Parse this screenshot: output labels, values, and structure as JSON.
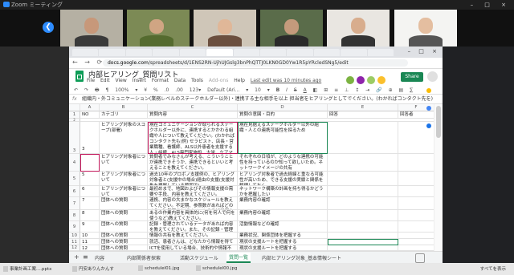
{
  "zoom": {
    "title": "Zoom ミーティング",
    "window_controls": "– □ ×"
  },
  "browser": {
    "nav": "← → ⟳",
    "url_host": "docs.google.com",
    "url_path": "/spreadsheets/d/1ENS2RN-UjhUJGslg3bnPhQTTJ0LKN0GD0Yw1R5pYRcledSNg5/edit"
  },
  "sheet": {
    "title": "内部ヒアリング_質問リスト",
    "star": "☆",
    "menus": [
      "File",
      "Edit",
      "View",
      "Insert",
      "Format",
      "Data",
      "Tools",
      "Add-ons",
      "Help"
    ],
    "last_edit": "Last edit was 10 minutes ago",
    "share_label": "Share",
    "toolbar": [
      "↶",
      "↷",
      "🖶",
      "¶",
      "100%",
      "▾",
      "¥",
      "%",
      ".0",
      ".00",
      "123▾",
      "Default (Ari...",
      "▾",
      "10",
      "▾",
      "B",
      "I",
      "S",
      "A",
      "◧",
      "⊞",
      "≡",
      "⊥",
      "↕",
      "⇥",
      "🔗",
      "⊕",
      "▤",
      "∑"
    ],
    "formula_prefix": "fx",
    "formula_text": "組織内・外コミュニケーション(業務レベルのステークホルダー以外)・連携する主な相手を以上 担当者をヒアリングとしてでください。(わかればコンタクト先を)",
    "columns": [
      "A",
      "B",
      "C",
      "D",
      "E",
      "F"
    ],
    "header_row": {
      "num": "1",
      "no": "NO",
      "category": "カテゴリ",
      "question": "質問内容",
      "respondent": "質問の意図・目的",
      "answer": "回答",
      "answer_to": "回答者"
    },
    "rows": [
      {
        "num": "2",
        "no": "",
        "category": "",
        "question": "",
        "purpose": ""
      },
      {
        "num": "3",
        "no": "3",
        "category": "ヒアリング対象のスコープ(部署)",
        "question": "現在コミュニケーションが取られるステークホルダー以外に、連携するとかかわる組織や人について教えてください。(わかればコンタクト先も)例) セラピスト、店長・営業職種、看護師、ALS以外患者を支援する人・組織、ALS専門家施設、大学、ケアマネージャーの仲も入れるならば、総括の情報があれば",
        "purpose": "現在見据えるステークホルダー以外の組織・人との連携可能性を探るため"
      },
      {
        "num": "4",
        "no": "4",
        "category": "ヒアリング対象者について",
        "question": "質問者でみなさんが考える、こういうことが連携できそうか、連携できるといいと考えることを教えてください。",
        "purpose": "それぞれの日頃が、どのような連携の可能性を持っているのか知って欲しいため。ネットワークイメージの共有"
      },
      {
        "num": "5",
        "no": "5",
        "category": "ヒアリング対象者について",
        "question": "過去10年のプロボノ支援例の、ヒアリング対象者と(支援中の場合)経由の支援(支援対象を把握している範囲で)",
        "purpose": "ヒアリング対象者で過去経緯と重なる可能性が高いため、できる支援の実績と関係を整理しておく"
      },
      {
        "num": "6",
        "no": "6",
        "category": "ヒアリング対象者について",
        "question": "最初めまで、地図およびその情報支援の需要や手段、内容を教えてください。",
        "purpose": "ネットワーク構築の計画を持ち得るかどうかを把握したい"
      },
      {
        "num": "7",
        "no": "7",
        "category": "団体への質問",
        "question": "連携、内容の大まかなスケジュールを教えてください。不定期、参照数があればどのくらい？毎週あればイベントの参加状況を",
        "purpose": "業務内容の確認"
      },
      {
        "num": "8",
        "no": "8",
        "category": "団体への質問",
        "question": "あるの作業内容を具体的に(何を何人で何を使うなど)教えてください。",
        "purpose": "業務内容の確認"
      },
      {
        "num": "9",
        "no": "9",
        "category": "団体への質問",
        "question": "記録・管理されているデータがあれば内容を教えてください。また、その記録・管理手段を教えてください。",
        "purpose": "活動情報などの確認"
      },
      {
        "num": "10",
        "no": "10",
        "category": "団体への質問",
        "question": "情報の共有を教えてください。",
        "purpose": "業務状況、関係団体を把握する"
      },
      {
        "num": "11",
        "no": "11",
        "category": "団体への質問",
        "question": "就活、患者さんは、どなたから情報を得て今の利用を把握しているのですか。",
        "purpose": "現状の支援ルートを把握する"
      },
      {
        "num": "12",
        "no": "12",
        "category": "団体への質問",
        "question": "ICTを使用している場合、技術的や情報不足などの理由で活用が取れていない",
        "purpose": "現状の支援ルートを把握する"
      }
    ],
    "tabs": [
      "内容",
      "内部関係者探索",
      "活動スケジュール",
      "質問一覧",
      "内部ヒアリング対象_基本情報シート"
    ],
    "active_tab": "質問一覧"
  },
  "taskbar": {
    "items": [
      "事業計画工案....pptx",
      "円安ありんかんす",
      "schedulel01.jpg",
      "schedulel00.jpg"
    ],
    "show_all": "すべてを表示"
  },
  "colors": {
    "accent_green": "#1a8754",
    "zoom_blue": "#2d8cff",
    "selection_red": "#c2185b"
  }
}
